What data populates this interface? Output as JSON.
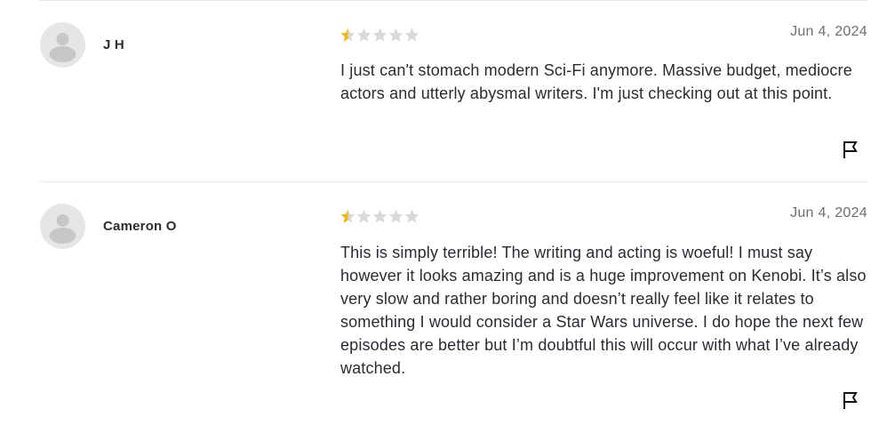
{
  "colors": {
    "star_filled": "#f5b50a",
    "star_empty": "#d9d9d9",
    "avatar_bg": "#e6e6e6",
    "avatar_figure": "#c7c7c7",
    "divider": "#e9e9e9"
  },
  "reviews": [
    {
      "reviewer_name": "J H",
      "rating": 0.5,
      "rating_max": 5,
      "date": "Jun 4, 2024",
      "text": "I just can't stomach modern Sci-Fi anymore. Massive budget, mediocre actors and utterly abysmal writers. I'm just checking out at this point.",
      "avatar_icon": "user-avatar-icon",
      "report_icon": "flag-icon"
    },
    {
      "reviewer_name": "Cameron O",
      "rating": 0.5,
      "rating_max": 5,
      "date": "Jun 4, 2024",
      "text": "This is simply terrible! The writing and acting is woeful! I must say however it looks amazing and is a huge improvement on Kenobi. It’s also very slow and rather boring and doesn’t really feel like it relates to something I would consider a Star Wars universe. I do hope the next few episodes are better but I’m doubtful this will occur with what I’ve already watched.",
      "avatar_icon": "user-avatar-icon",
      "report_icon": "flag-icon"
    }
  ]
}
